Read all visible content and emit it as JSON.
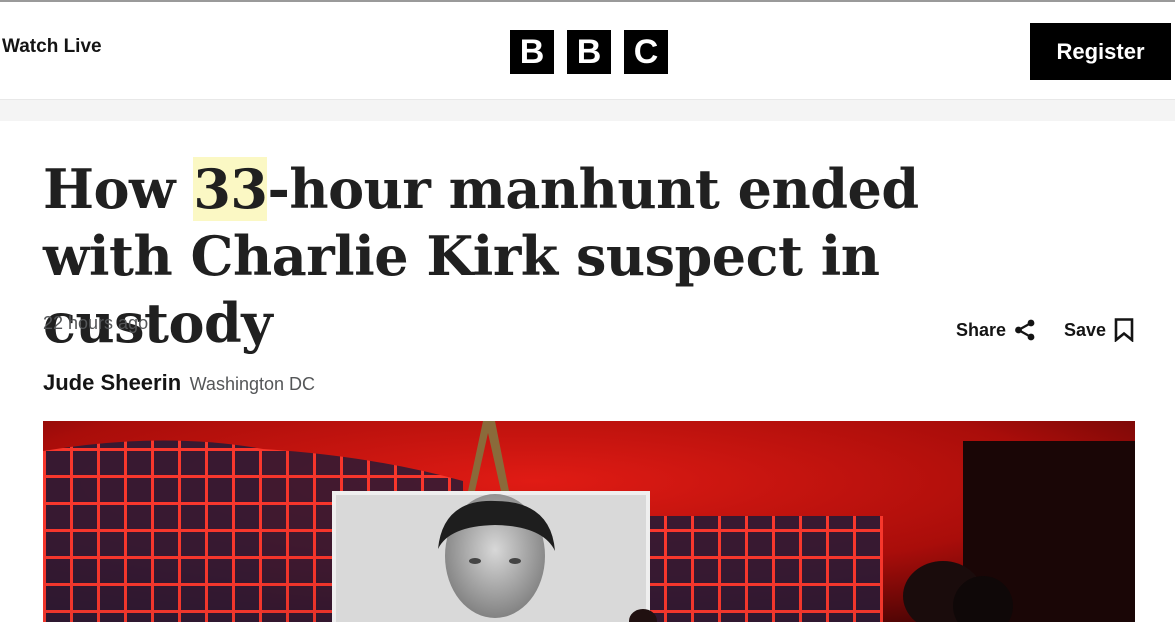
{
  "header": {
    "watch_live": "Watch Live",
    "logo_letters": [
      "B",
      "B",
      "C"
    ],
    "register_label": "Register"
  },
  "article": {
    "headline_pre": "How ",
    "headline_highlight": "33",
    "headline_post": "-hour manhunt ended with Charlie Kirk suspect in custody",
    "timestamp": "22 hours ago",
    "author": "Jude Sheerin",
    "location": "Washington DC",
    "share_label": "Share",
    "save_label": "Save"
  },
  "colors": {
    "brand": "#000000",
    "highlight": "#fbf8c4",
    "hero_red": "#b0100c"
  },
  "icons": [
    "share-icon",
    "bookmark-icon"
  ]
}
